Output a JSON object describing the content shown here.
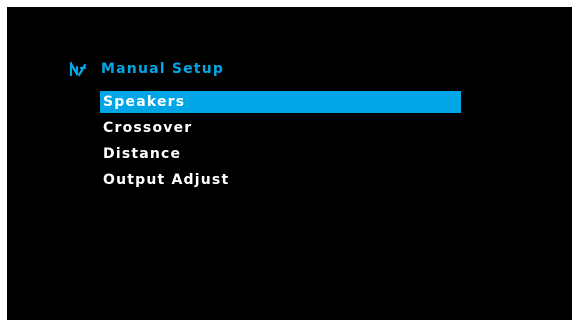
{
  "colors": {
    "background": "#000000",
    "accent": "#00a6e6",
    "text": "#ffffff",
    "selected_text": "#ffffff"
  },
  "header": {
    "icon": "speaker-setup-icon",
    "title": "Manual Setup"
  },
  "menu": {
    "selected_index": 0,
    "items": [
      {
        "label": "Speakers"
      },
      {
        "label": "Crossover"
      },
      {
        "label": "Distance"
      },
      {
        "label": "Output Adjust"
      }
    ]
  }
}
